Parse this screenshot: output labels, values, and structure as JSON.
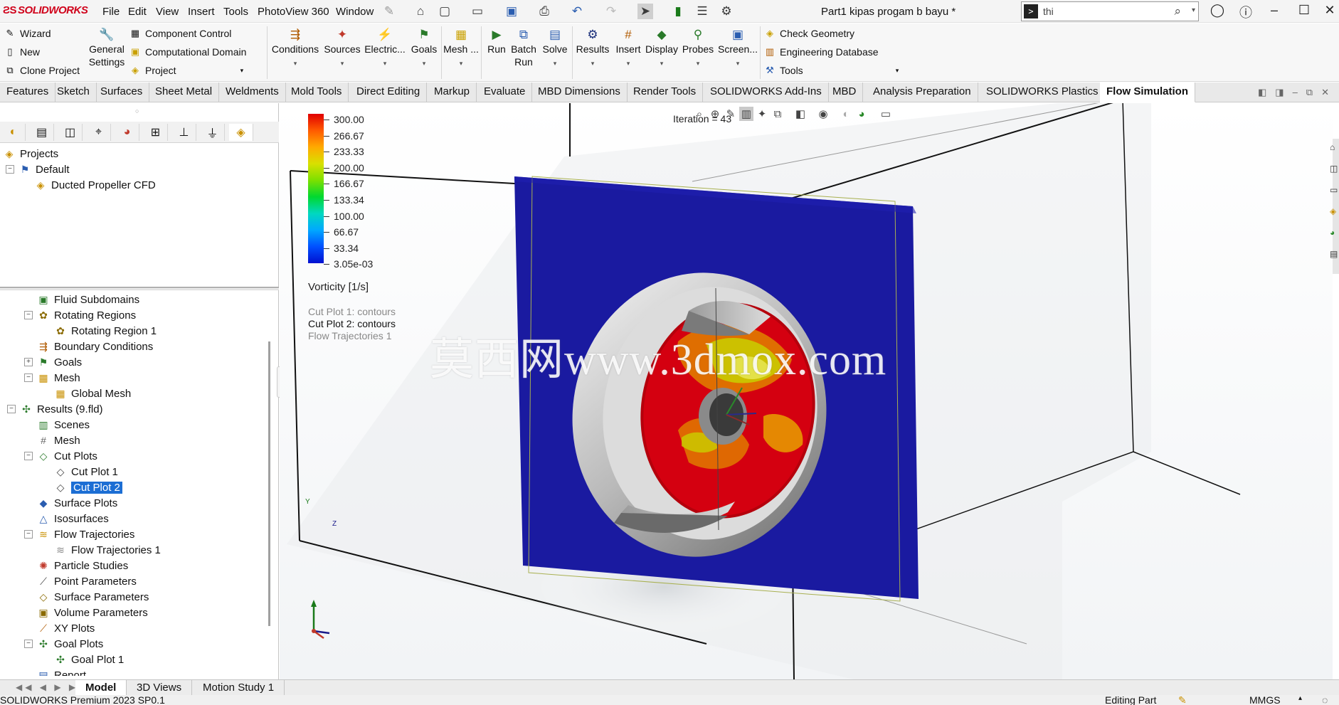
{
  "app": {
    "logo": "SOLIDWORKS",
    "document_title": "Part1 kipas progam b bayu *"
  },
  "menu": [
    "File",
    "Edit",
    "View",
    "Insert",
    "Tools",
    "PhotoView 360",
    "Window"
  ],
  "search": {
    "value": "thi"
  },
  "ribbon": {
    "left_items": [
      "Wizard",
      "New",
      "Clone Project"
    ],
    "general_settings": [
      "General",
      "Settings"
    ],
    "component_items": [
      "Component Control",
      "Computational Domain",
      "Project"
    ],
    "buttons": [
      "Conditions",
      "Sources",
      "Electric...",
      "Goals",
      "Mesh ...",
      "Run",
      "Batch Run",
      "Solve",
      "Results",
      "Insert",
      "Display",
      "Probes",
      "Screen..."
    ],
    "right_items": [
      "Check Geometry",
      "Engineering Database",
      "Tools"
    ]
  },
  "tabs": [
    "Features",
    "Sketch",
    "Surfaces",
    "Sheet Metal",
    "Weldments",
    "Mold Tools",
    "Direct Editing",
    "Markup",
    "Evaluate",
    "MBD Dimensions",
    "Render Tools",
    "SOLIDWORKS Add-Ins",
    "MBD",
    "Analysis Preparation",
    "SOLIDWORKS Plastics",
    "Flow Simulation"
  ],
  "active_tab": "Flow Simulation",
  "projects_tree": {
    "root": "Projects",
    "default": "Default",
    "project": "Ducted Propeller CFD"
  },
  "analysis_tree": [
    {
      "label": "Fluid Subdomains",
      "level": 1,
      "expander": "",
      "icon": "fluid-subdomain-icon"
    },
    {
      "label": "Rotating Regions",
      "level": 1,
      "expander": "−",
      "icon": "rotating-region-icon"
    },
    {
      "label": "Rotating Region 1",
      "level": 2,
      "expander": "",
      "icon": "rotating-region-icon"
    },
    {
      "label": "Boundary Conditions",
      "level": 1,
      "expander": "",
      "icon": "boundary-conditions-icon"
    },
    {
      "label": "Goals",
      "level": 1,
      "expander": "+",
      "icon": "goals-icon"
    },
    {
      "label": "Mesh",
      "level": 1,
      "expander": "−",
      "icon": "mesh-icon"
    },
    {
      "label": "Global Mesh",
      "level": 2,
      "expander": "",
      "icon": "global-mesh-icon"
    },
    {
      "label": "Results (9.fld)",
      "level": 0,
      "expander": "−",
      "icon": "results-icon"
    },
    {
      "label": "Scenes",
      "level": 1,
      "expander": "",
      "icon": "scenes-icon"
    },
    {
      "label": "Mesh",
      "level": 1,
      "expander": "",
      "icon": "mesh-grid-icon"
    },
    {
      "label": "Cut Plots",
      "level": 1,
      "expander": "−",
      "icon": "cut-plots-icon"
    },
    {
      "label": "Cut Plot 1",
      "level": 2,
      "expander": "",
      "icon": "cut-plot-icon"
    },
    {
      "label": "Cut Plot 2",
      "level": 2,
      "expander": "",
      "icon": "cut-plot-icon",
      "selected": true
    },
    {
      "label": "Surface Plots",
      "level": 1,
      "expander": "",
      "icon": "surface-plots-icon"
    },
    {
      "label": "Isosurfaces",
      "level": 1,
      "expander": "",
      "icon": "isosurfaces-icon"
    },
    {
      "label": "Flow Trajectories",
      "level": 1,
      "expander": "−",
      "icon": "flow-trajectories-icon"
    },
    {
      "label": "Flow Trajectories 1",
      "level": 2,
      "expander": "",
      "icon": "flow-trajectory-icon"
    },
    {
      "label": "Particle Studies",
      "level": 1,
      "expander": "",
      "icon": "particle-studies-icon"
    },
    {
      "label": "Point Parameters",
      "level": 1,
      "expander": "",
      "icon": "point-parameters-icon"
    },
    {
      "label": "Surface Parameters",
      "level": 1,
      "expander": "",
      "icon": "surface-parameters-icon"
    },
    {
      "label": "Volume Parameters",
      "level": 1,
      "expander": "",
      "icon": "volume-parameters-icon"
    },
    {
      "label": "XY Plots",
      "level": 1,
      "expander": "",
      "icon": "xy-plots-icon"
    },
    {
      "label": "Goal Plots",
      "level": 1,
      "expander": "−",
      "icon": "goal-plots-icon"
    },
    {
      "label": "Goal Plot 1",
      "level": 2,
      "expander": "",
      "icon": "goal-plot-icon"
    },
    {
      "label": "Report",
      "level": 1,
      "expander": "",
      "icon": "report-icon"
    }
  ],
  "legend": {
    "labels": [
      "300.00",
      "266.67",
      "233.33",
      "200.00",
      "166.67",
      "133.34",
      "100.00",
      "66.67",
      "33.34",
      "3.05e-03"
    ],
    "quantity": "Vorticity [1/s]",
    "colors": [
      "#e00000",
      "#ff5a00",
      "#ffaa00",
      "#d9e000",
      "#7de000",
      "#00d830",
      "#00d8c0",
      "#00a8ff",
      "#0050ff",
      "#0010d0"
    ]
  },
  "viewport": {
    "iteration": "Iteration = 43",
    "plots": [
      {
        "label": "Cut Plot 1: contours",
        "active": false
      },
      {
        "label": "Cut Plot 2: contours",
        "active": true
      },
      {
        "label": "Flow Trajectories 1",
        "active": false
      }
    ],
    "watermark": "莫西网www.3dmox.com",
    "triad": {
      "y": "Y",
      "z": "Z"
    }
  },
  "bottom_tabs": [
    "Model",
    "3D Views",
    "Motion Study 1"
  ],
  "status": {
    "left": "SOLIDWORKS Premium 2023 SP0.1",
    "editing": "Editing Part",
    "units": "MMGS"
  },
  "colors": {
    "selection": "#1c6ed4",
    "plane": "#1a1aa0",
    "accent": "#d0021b"
  }
}
